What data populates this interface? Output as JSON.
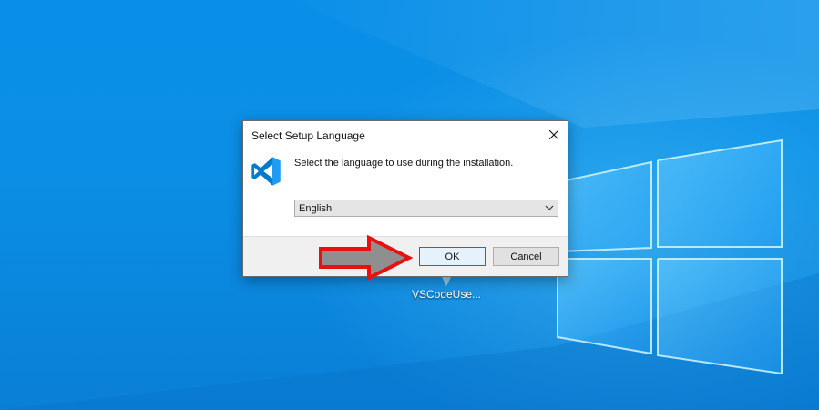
{
  "dialog": {
    "title": "Select Setup Language",
    "prompt": "Select the language to use during the installation.",
    "language_selected": "English",
    "ok_label": "OK",
    "cancel_label": "Cancel"
  },
  "desktop": {
    "icon_label": "VSCodeUse..."
  },
  "colors": {
    "desktop_blue": "#0a8fe8",
    "vscode_blue": "#0078d4",
    "arrow_red": "#e81010",
    "arrow_gray": "#8f8f8f"
  },
  "icons": [
    "vscode-logo-icon",
    "close-icon",
    "chevron-down-icon",
    "annotation-arrow",
    "desktop-file-icon"
  ]
}
